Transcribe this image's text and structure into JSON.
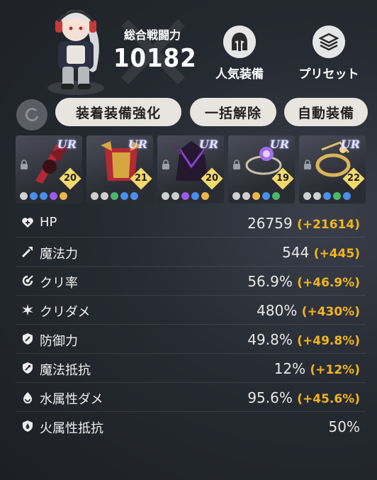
{
  "header": {
    "power_title": "総合戦闘力",
    "power_value": "10182",
    "buttons": [
      {
        "label": "人気装備",
        "icon": "spartan-helmet-icon"
      },
      {
        "label": "プリセット",
        "icon": "stack-layers-icon"
      }
    ]
  },
  "toolbar": {
    "refresh_icon": "refresh-icon",
    "buttons": [
      "装着装備強化",
      "一括解除",
      "自動装備"
    ]
  },
  "equipment": [
    {
      "rarity": "UR",
      "level": "20"
    },
    {
      "rarity": "UR",
      "level": "21"
    },
    {
      "rarity": "UR",
      "level": "20"
    },
    {
      "rarity": "UR",
      "level": "19"
    },
    {
      "rarity": "UR",
      "level": "22"
    }
  ],
  "stats": [
    {
      "name": "HP",
      "value": "26759",
      "bonus": "(+21614)",
      "icon": "heart-plus-icon"
    },
    {
      "name": "魔法力",
      "value": "544",
      "bonus": "(+445)",
      "icon": "wand-icon"
    },
    {
      "name": "クリ率",
      "value": "56.9%",
      "bonus": "(+46.9%)",
      "icon": "crit-rate-icon"
    },
    {
      "name": "クリダメ",
      "value": "480%",
      "bonus": "(+430%)",
      "icon": "crit-damage-icon"
    },
    {
      "name": "防御力",
      "value": "49.8%",
      "bonus": "(+49.8%)",
      "icon": "shield-icon"
    },
    {
      "name": "魔法抵抗",
      "value": "12%",
      "bonus": "(+12%)",
      "icon": "magic-resist-icon"
    },
    {
      "name": "水属性ダメ",
      "value": "95.6%",
      "bonus": "(+45.6%)",
      "icon": "water-element-icon"
    },
    {
      "name": "火属性抵抗",
      "value": "50%",
      "bonus": "",
      "icon": "fire-resist-icon"
    }
  ],
  "colors": {
    "bonus": "#f2b51e",
    "level_badge": "#f3d96a",
    "button_bg": "#e8e5e1"
  }
}
